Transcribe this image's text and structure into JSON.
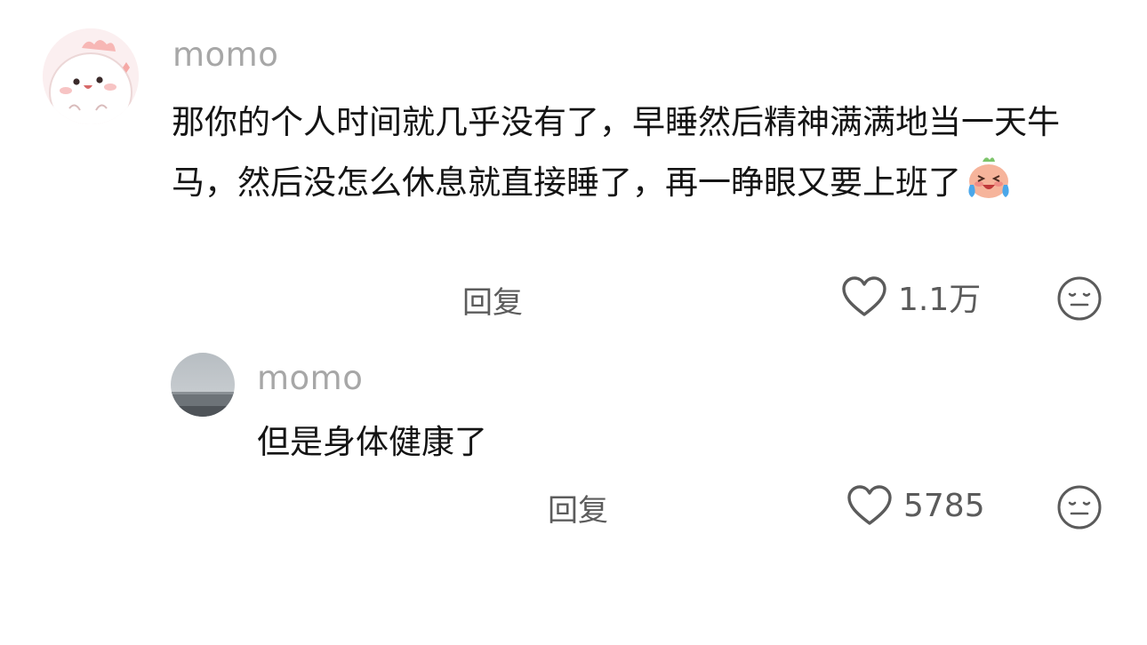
{
  "comments": [
    {
      "username": "momo",
      "text": "那你的个人时间就几乎没有了，早睡然后精神满满地当一天牛马，然后没怎么休息就直接睡了，再一睁眼又要上班了",
      "emoji": "laugh-cry-emoji",
      "reply_label": "回复",
      "likes": "1.1万"
    },
    {
      "username": "momo",
      "text": "但是身体健康了",
      "reply_label": "回复",
      "likes": "5785"
    }
  ],
  "icons": {
    "like": "heart-outline-icon",
    "dislike": "meh-face-icon"
  },
  "colors": {
    "username": "#a7a7a7",
    "text": "#141414",
    "secondary": "#5c5c5c"
  }
}
